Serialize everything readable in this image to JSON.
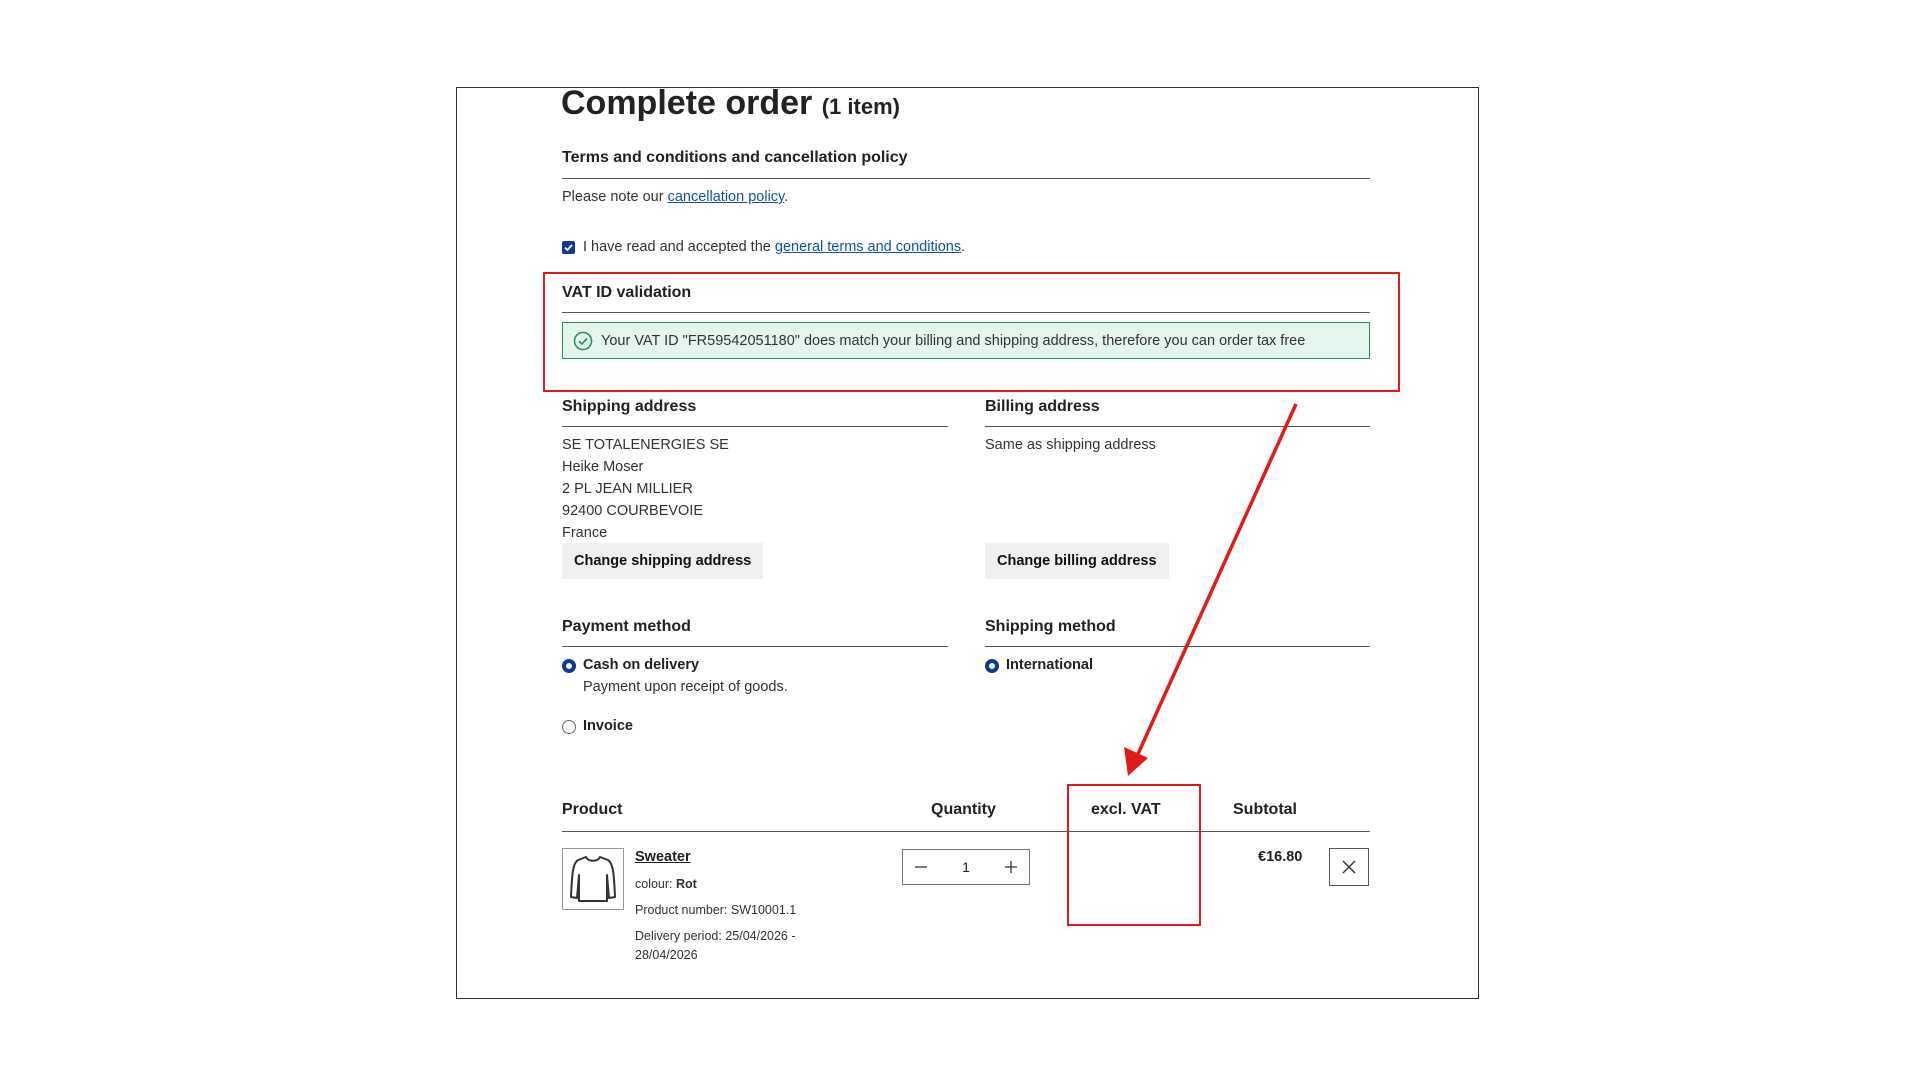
{
  "page": {
    "title": "Complete order",
    "item_count": "(1 item)"
  },
  "terms": {
    "heading": "Terms and conditions and cancellation policy",
    "note_prefix": "Please note our ",
    "note_link": "cancellation policy",
    "note_suffix": ".",
    "accept_prefix": "I have read and accepted the ",
    "accept_link": "general terms and conditions",
    "accept_suffix": ".",
    "accepted": true
  },
  "vat": {
    "heading": "VAT ID validation",
    "message": "Your VAT ID \"FR59542051180\" does match your billing and shipping address, therefore you can order tax free",
    "icon": "check-circle-icon",
    "status_color": "#2f8f5f"
  },
  "shipping_address": {
    "heading": "Shipping address",
    "lines": [
      "SE TOTALENERGIES SE",
      "Heike Moser",
      "2 PL JEAN MILLIER",
      "92400 COURBEVOIE",
      "France"
    ],
    "change_label": "Change shipping address"
  },
  "billing_address": {
    "heading": "Billing address",
    "text": "Same as shipping address",
    "change_label": "Change billing address"
  },
  "payment": {
    "heading": "Payment method",
    "options": [
      {
        "label": "Cash on delivery",
        "description": "Payment upon receipt of goods.",
        "selected": true
      },
      {
        "label": "Invoice",
        "description": "",
        "selected": false
      }
    ]
  },
  "shipping_method": {
    "heading": "Shipping method",
    "options": [
      {
        "label": "International",
        "selected": true
      }
    ]
  },
  "cart": {
    "headers": {
      "product": "Product",
      "quantity": "Quantity",
      "vat": "excl. VAT",
      "subtotal": "Subtotal"
    },
    "items": [
      {
        "name": "Sweater",
        "attr_label": "colour: ",
        "attr_value": "Rot",
        "product_number": "Product number: SW10001.1",
        "delivery_line1": "Delivery period: 25/04/2026 -",
        "delivery_line2": "28/04/2026",
        "quantity": "1",
        "subtotal": "€16.80",
        "icon": "sweater-icon"
      }
    ]
  },
  "colors": {
    "accent": "#0b3c91",
    "link": "#0b55a8",
    "annotation": "#e01b1b",
    "success_bg": "#e4f5ee"
  }
}
